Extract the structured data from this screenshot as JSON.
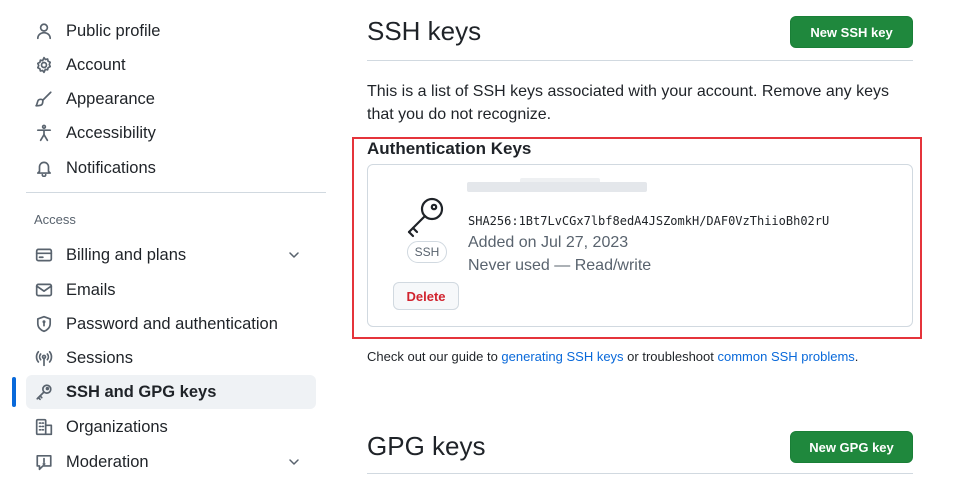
{
  "sidebar": {
    "items": [
      {
        "label": "Public profile",
        "icon": "person-icon"
      },
      {
        "label": "Account",
        "icon": "gear-icon"
      },
      {
        "label": "Appearance",
        "icon": "paintbrush-icon"
      },
      {
        "label": "Accessibility",
        "icon": "accessibility-icon"
      },
      {
        "label": "Notifications",
        "icon": "bell-icon"
      }
    ],
    "section_label": "Access",
    "access_items": [
      {
        "label": "Billing and plans",
        "icon": "credit-card-icon",
        "has_chevron": true
      },
      {
        "label": "Emails",
        "icon": "mail-icon"
      },
      {
        "label": "Password and authentication",
        "icon": "shield-lock-icon"
      },
      {
        "label": "Sessions",
        "icon": "broadcast-icon"
      },
      {
        "label": "SSH and GPG keys",
        "icon": "key-icon",
        "active": true
      },
      {
        "label": "Organizations",
        "icon": "organization-icon"
      },
      {
        "label": "Moderation",
        "icon": "report-icon",
        "has_chevron": true
      }
    ]
  },
  "main": {
    "ssh_title": "SSH keys",
    "new_ssh_button": "New SSH key",
    "description": "This is a list of SSH keys associated with your account. Remove any keys that you do not recognize.",
    "auth_keys_title": "Authentication Keys",
    "key": {
      "badge": "SSH",
      "fingerprint": "SHA256:1Bt7LvCGx7lbf8edA4JSZomkH/DAF0VzThiioBh02rU",
      "added": "Added on Jul 27, 2023",
      "usage": "Never used — Read/write",
      "delete_label": "Delete"
    },
    "guide": {
      "prefix": "Check out our guide to ",
      "link1": "generating SSH keys",
      "middle": " or troubleshoot ",
      "link2": "common SSH problems",
      "suffix": "."
    },
    "gpg_title": "GPG keys",
    "new_gpg_button": "New GPG key"
  },
  "colors": {
    "accent": "#0969da",
    "primary_button": "#1f883d",
    "danger": "#d1242f",
    "highlight_border": "#e5343b"
  }
}
